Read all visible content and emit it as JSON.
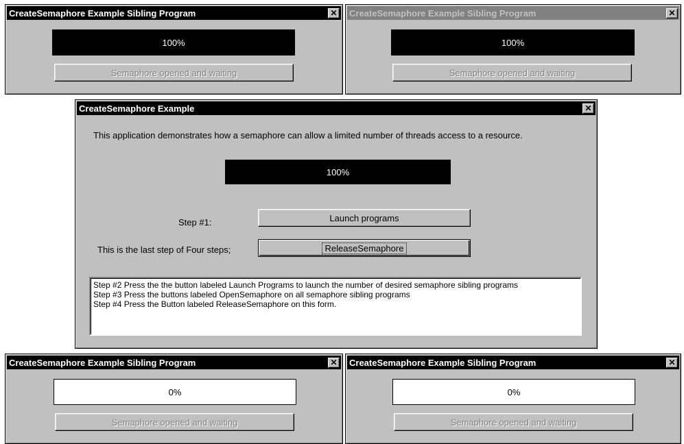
{
  "sibling_tl": {
    "title": "CreateSemaphore Example Sibling Program",
    "progress_text": "100%",
    "progress": 1.0,
    "button_label": "Semaphore opened and waiting",
    "close_icon": "close-icon"
  },
  "sibling_tr": {
    "title": "CreateSemaphore Example Sibling Program",
    "progress_text": "100%",
    "progress": 1.0,
    "button_label": "Semaphore opened and waiting",
    "close_icon": "close-icon"
  },
  "main": {
    "title": "CreateSemaphore Example",
    "description": "This application demonstrates how a semaphore can allow a limited number of threads access to a resource.",
    "progress_text": "100%",
    "progress": 1.0,
    "step1_label": "Step #1:",
    "launch_button": "Launch programs",
    "last_step_label": "This is the last step of Four steps;",
    "release_button": "ReleaseSemaphore",
    "instructions": [
      "Step #2 Press the the button labeled Launch Programs to launch the number of desired semaphore sibling programs",
      "Step #3 Press the buttons labeled OpenSemaphore on all semaphore sibling programs",
      "Step #4 Press the Button labeled ReleaseSemaphore on this form."
    ]
  },
  "sibling_bl": {
    "title": "CreateSemaphore Example Sibling Program",
    "progress_text": "0%",
    "progress": 0.0,
    "button_label": "Semaphore opened and waiting"
  },
  "sibling_br": {
    "title": "CreateSemaphore Example Sibling Program",
    "progress_text": "0%",
    "progress": 0.0,
    "button_label": "Semaphore opened and waiting"
  }
}
